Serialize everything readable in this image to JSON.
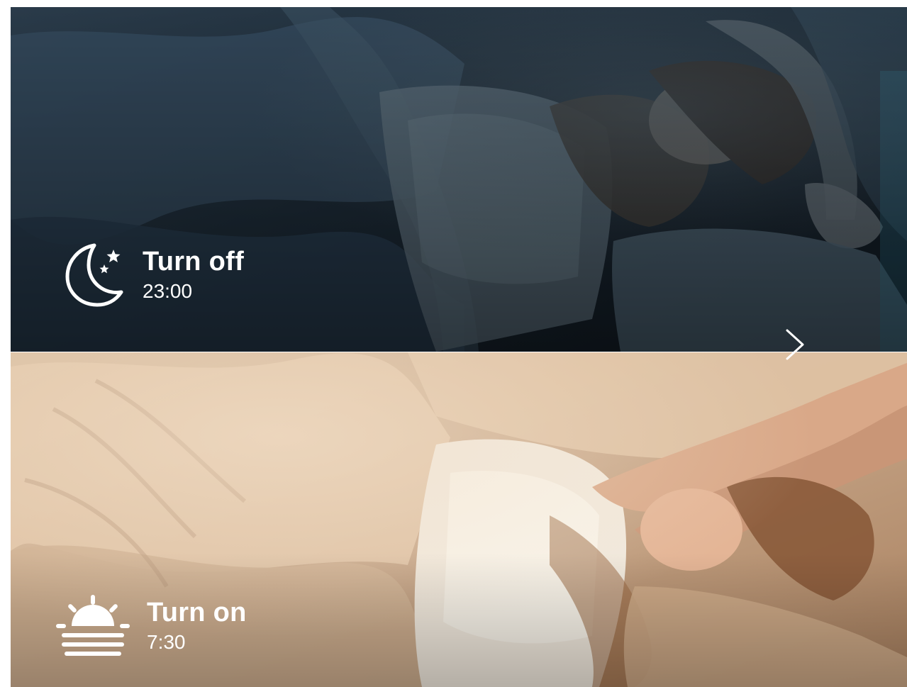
{
  "night": {
    "title": "Turn off",
    "time": "23:00",
    "icon": "moon-stars-icon",
    "scene": "person sleeping in bed at night"
  },
  "day": {
    "title": "Turn on",
    "time": "7:30",
    "icon": "sunrise-icon",
    "scene": "person stretching in bed in the morning"
  },
  "navigation": {
    "next_icon": "chevron-right-icon"
  },
  "colors": {
    "night_tint": "#1b2a36",
    "day_tint": "#d8b896",
    "text": "#ffffff"
  }
}
